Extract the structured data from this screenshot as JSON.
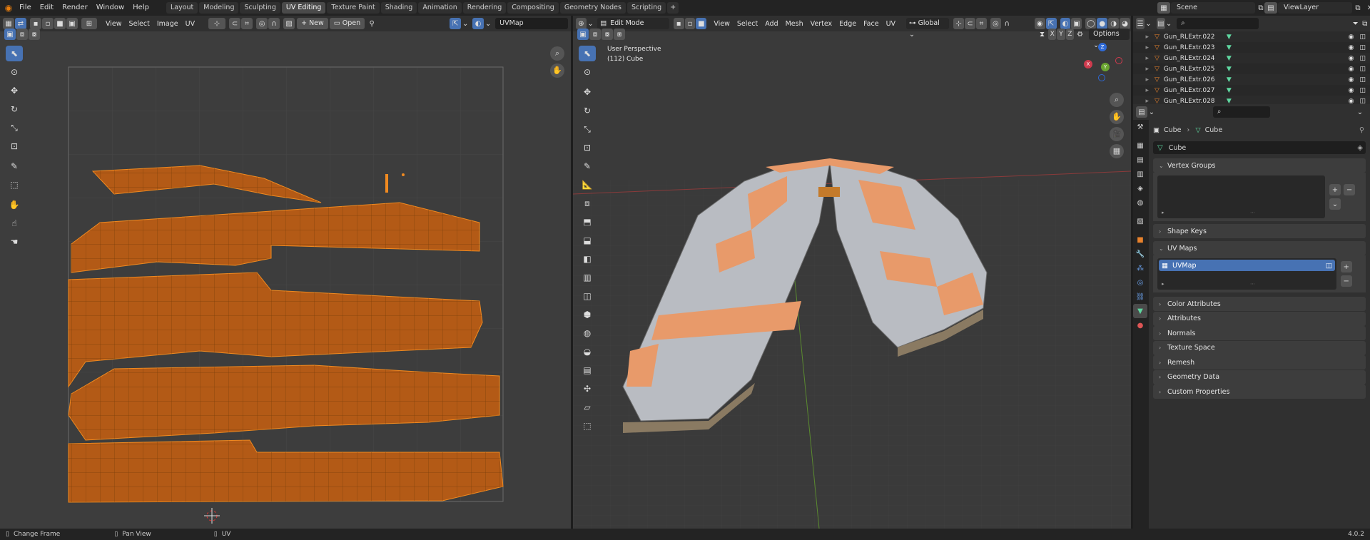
{
  "topbar": {
    "menus": [
      "File",
      "Edit",
      "Render",
      "Window",
      "Help"
    ],
    "workspaces": [
      "Layout",
      "Modeling",
      "Sculpting",
      "UV Editing",
      "Texture Paint",
      "Shading",
      "Animation",
      "Rendering",
      "Compositing",
      "Geometry Nodes",
      "Scripting"
    ],
    "active_workspace": "UV Editing",
    "scene": "Scene",
    "view_layer": "ViewLayer"
  },
  "uv_editor": {
    "menus": [
      "View",
      "Select",
      "Image",
      "UV"
    ],
    "new_label": "New",
    "open_label": "Open",
    "uvmap_name": "UVMap"
  },
  "viewport": {
    "mode": "Edit Mode",
    "menus": [
      "View",
      "Select",
      "Add",
      "Mesh",
      "Vertex",
      "Edge",
      "Face",
      "UV"
    ],
    "orientation": "Global",
    "options_label": "Options",
    "xyz": [
      "X",
      "Y",
      "Z"
    ],
    "overlay_title": "User Perspective",
    "overlay_object": "(112) Cube"
  },
  "outliner": {
    "items": [
      "Gun_RLExtr.022",
      "Gun_RLExtr.023",
      "Gun_RLExtr.024",
      "Gun_RLExtr.025",
      "Gun_RLExtr.026",
      "Gun_RLExtr.027",
      "Gun_RLExtr.028"
    ]
  },
  "properties": {
    "breadcrumb_object": "Cube",
    "breadcrumb_mesh": "Cube",
    "mesh_name": "Cube",
    "vertex_groups": "Vertex Groups",
    "shape_keys": "Shape Keys",
    "uv_maps": "UV Maps",
    "uv_map_item": "UVMap",
    "collapsed_panels": [
      "Color Attributes",
      "Attributes",
      "Normals",
      "Texture Space",
      "Remesh",
      "Geometry Data",
      "Custom Properties"
    ]
  },
  "statusbar": {
    "left": "Change Frame",
    "middle": "Pan View",
    "right_action": "UV",
    "version": "4.0.2"
  },
  "colors": {
    "accent": "#4772b3",
    "uv_orange": "#e8821c",
    "mesh_orange": "#e89a6a",
    "mesh_grey": "#b9bcc2"
  }
}
